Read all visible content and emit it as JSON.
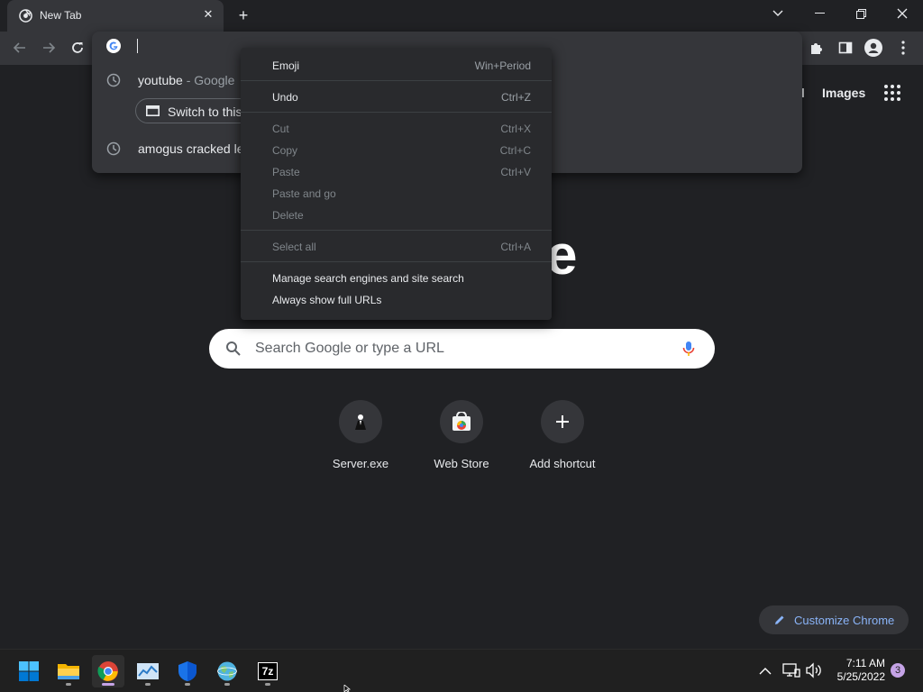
{
  "tab": {
    "title": "New Tab",
    "close": "✕",
    "new_tab": "+"
  },
  "window": {
    "minimize": "—",
    "maximize": "❐",
    "close": "✕"
  },
  "omnibox": {
    "suggestions": [
      {
        "text": "youtube",
        "sub": " - Google"
      },
      {
        "text": "amogus cracked le",
        "sub": ""
      }
    ],
    "switch_button_label": "Switch to this"
  },
  "ntp": {
    "top_links": {
      "gmail_fragment": "il",
      "images": "Images"
    },
    "logo_fragment": "e",
    "search_placeholder": "Search Google or type a URL",
    "shortcuts": [
      {
        "label": "Server.exe"
      },
      {
        "label": "Web Store"
      },
      {
        "label": "Add shortcut"
      }
    ],
    "customize_label": "Customize Chrome"
  },
  "context_menu": {
    "items": [
      {
        "label": "Emoji",
        "shortcut": "Win+Period",
        "enabled": true
      },
      {
        "label": "Undo",
        "shortcut": "Ctrl+Z",
        "enabled": true
      },
      {
        "label": "Cut",
        "shortcut": "Ctrl+X",
        "enabled": false
      },
      {
        "label": "Copy",
        "shortcut": "Ctrl+C",
        "enabled": false
      },
      {
        "label": "Paste",
        "shortcut": "Ctrl+V",
        "enabled": false
      },
      {
        "label": "Paste and go",
        "shortcut": "",
        "enabled": false
      },
      {
        "label": "Delete",
        "shortcut": "",
        "enabled": false
      },
      {
        "label": "Select all",
        "shortcut": "Ctrl+A",
        "enabled": false
      },
      {
        "label": "Manage search engines and site search",
        "shortcut": "",
        "enabled": true
      },
      {
        "label": "Always show full URLs",
        "shortcut": "",
        "enabled": true
      }
    ]
  },
  "taskbar": {
    "apps": [
      "start-icon",
      "file-explorer-icon",
      "chrome-icon",
      "task-manager-icon",
      "windows-security-icon",
      "network-globe-icon",
      "7zip-icon"
    ],
    "seven_zip_label": "7z",
    "time": "7:11 AM",
    "date": "5/25/2022",
    "notification_count": "3"
  },
  "colors": {
    "accent": "#8ab4f8",
    "page_bg": "#202124",
    "toolbar_bg": "#35363a",
    "menu_bg": "#292a2d"
  }
}
